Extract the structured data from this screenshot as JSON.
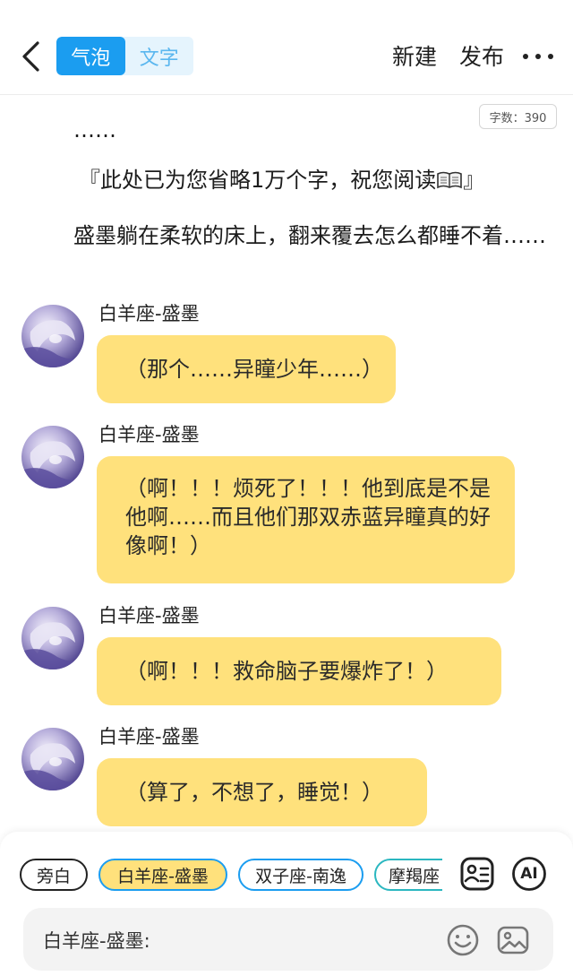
{
  "header": {
    "mode_tabs": [
      {
        "label": "气泡",
        "active": true
      },
      {
        "label": "文字",
        "active": false
      }
    ],
    "new_label": "新建",
    "publish_label": "发布",
    "back_icon": "chevron-left-icon",
    "more_icon": "more-horizontal-icon"
  },
  "word_count": "字数：390",
  "paragraphs": {
    "ellipsis": "……",
    "omitted_prefix": "『此处已为您省略1万个字，祝您阅读",
    "omitted_suffix": "』",
    "omitted_icon": "open-book-emoji",
    "body": "盛墨躺在柔软的床上，翻来覆去怎么都睡不着……"
  },
  "messages": [
    {
      "speaker": "白羊座-盛墨",
      "text": "（那个……异瞳少年……）"
    },
    {
      "speaker": "白羊座-盛墨",
      "text": "（啊！！！烦死了！！！他到底是不是他啊……而且他们那双赤蓝异瞳真的好像啊！）"
    },
    {
      "speaker": "白羊座-盛墨",
      "text": "（啊！！！救命脑子要爆炸了！）"
    },
    {
      "speaker": "白羊座-盛墨",
      "text": "（算了，不想了，睡觉！）"
    }
  ],
  "characters": [
    {
      "label": "旁白",
      "selected": false
    },
    {
      "label": "白羊座-盛墨",
      "selected": true
    },
    {
      "label": "双子座-南逸",
      "selected": false
    },
    {
      "label": "摩羯座",
      "selected": false
    }
  ],
  "toolbar": {
    "contacts_icon": "contact-card-icon",
    "ai_label": "AI"
  },
  "input": {
    "label": "白羊座-盛墨:",
    "emoji_icon": "smiley-icon",
    "image_icon": "image-icon"
  },
  "colors": {
    "accent": "#1b9df0",
    "bubble": "#ffe17c",
    "toggle_bg": "#e5f4fd"
  }
}
